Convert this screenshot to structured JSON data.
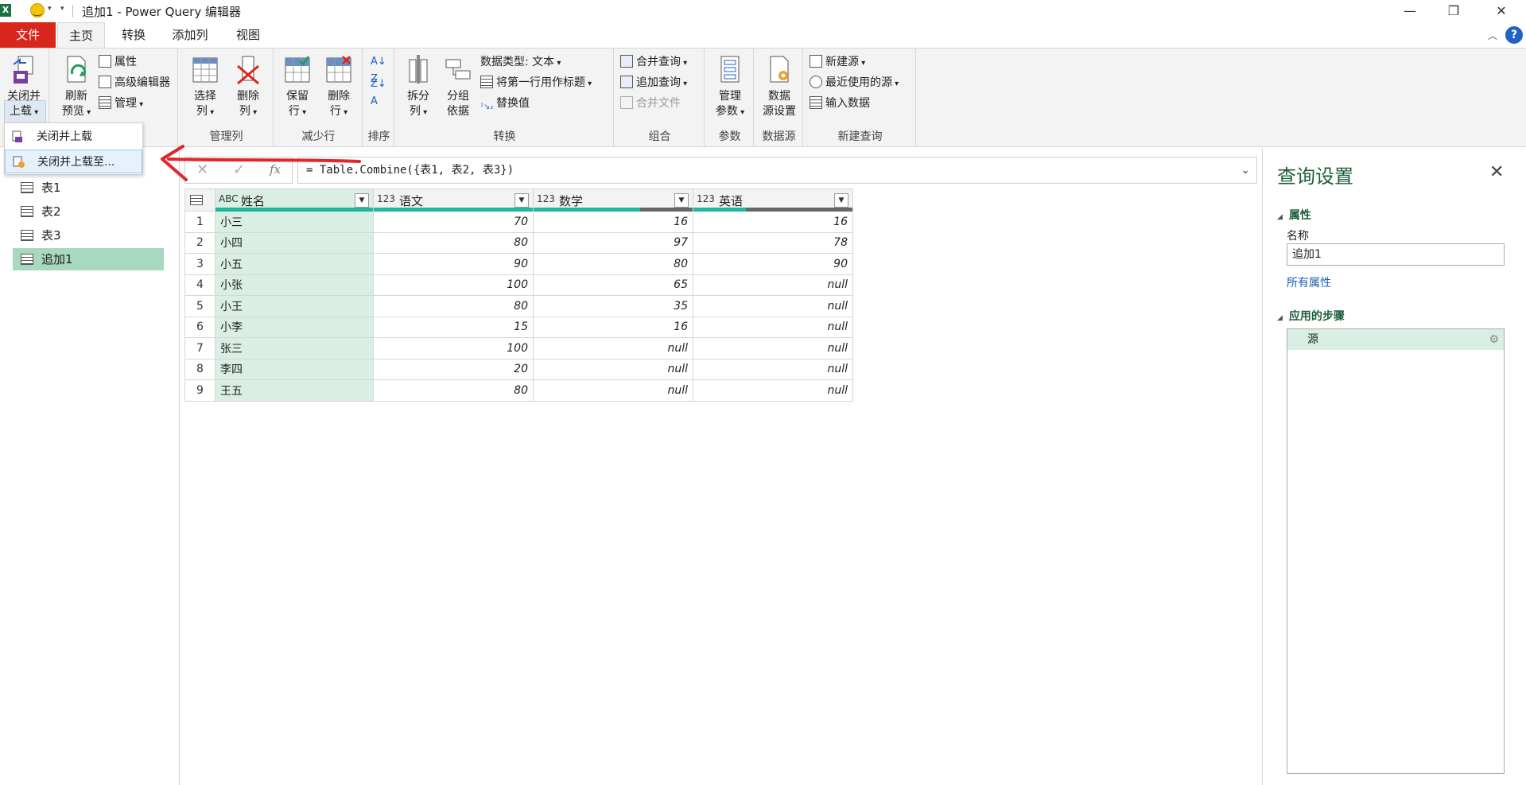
{
  "window": {
    "title": "追加1 - Power Query 编辑器",
    "app_icon": "X"
  },
  "tabs": [
    {
      "label": "文件"
    },
    {
      "label": "主页"
    },
    {
      "label": "转换"
    },
    {
      "label": "添加列"
    },
    {
      "label": "视图"
    }
  ],
  "ribbon": {
    "close_load": "关闭并",
    "close_load2": "上载",
    "refresh": "刷新",
    "refresh2": "预览",
    "properties": "属性",
    "advanced_editor": "高级编辑器",
    "manage": "管理",
    "choose_cols": "选择",
    "choose_cols2": "列",
    "remove_cols": "删除",
    "remove_cols2": "列",
    "keep_rows": "保留",
    "keep_rows2": "行",
    "remove_rows": "删除",
    "remove_rows2": "行",
    "split_col": "拆分",
    "split_col2": "列",
    "group_by": "分组",
    "group_by2": "依据",
    "data_type": "数据类型: 文本",
    "first_row_header": "将第一行用作标题",
    "replace_values": "替换值",
    "merge_queries": "合并查询",
    "append_queries": "追加查询",
    "combine_files": "合并文件",
    "manage_params": "管理",
    "manage_params2": "参数",
    "data_source_settings": "数据",
    "data_source_settings2": "源设置",
    "new_source": "新建源",
    "recent_sources": "最近使用的源",
    "enter_data": "输入数据",
    "groups": {
      "manage_cols": "管理列",
      "reduce_rows": "减少行",
      "sort": "排序",
      "transform": "转换",
      "combine": "组合",
      "params": "参数",
      "data_source": "数据源",
      "new_query": "新建查询"
    }
  },
  "menu": {
    "item1": "关闭并上载",
    "item2": "关闭并上载至..."
  },
  "queries": [
    {
      "label": "表1"
    },
    {
      "label": "表2"
    },
    {
      "label": "表3"
    },
    {
      "label": "追加1"
    }
  ],
  "formula": {
    "text": "= Table.Combine({表1, 表2, 表3})",
    "fx": "fx"
  },
  "grid": {
    "columns": [
      {
        "type": "ABC",
        "name": "姓名",
        "quality": 1.0
      },
      {
        "type": "123",
        "name": "语文",
        "quality": 1.0
      },
      {
        "type": "123",
        "name": "数学",
        "quality": 0.67
      },
      {
        "type": "123",
        "name": "英语",
        "quality": 0.33
      }
    ],
    "rows": [
      [
        "1",
        "小三",
        "70",
        "16",
        "16"
      ],
      [
        "2",
        "小四",
        "80",
        "97",
        "78"
      ],
      [
        "3",
        "小五",
        "90",
        "80",
        "90"
      ],
      [
        "4",
        "小张",
        "100",
        "65",
        "null"
      ],
      [
        "5",
        "小王",
        "80",
        "35",
        "null"
      ],
      [
        "6",
        "小李",
        "15",
        "16",
        "null"
      ],
      [
        "7",
        "张三",
        "100",
        "null",
        "null"
      ],
      [
        "8",
        "李四",
        "20",
        "null",
        "null"
      ],
      [
        "9",
        "王五",
        "80",
        "null",
        "null"
      ]
    ]
  },
  "settings": {
    "title": "查询设置",
    "properties_header": "属性",
    "name_label": "名称",
    "name_value": "追加1",
    "all_properties": "所有属性",
    "steps_header": "应用的步骤",
    "steps": [
      {
        "label": "源"
      }
    ]
  },
  "colors": {
    "file_tab": "#d9261c",
    "selected_query": "#a8d8bd",
    "quality_bar": "#1fb89c",
    "accent_green": "#1b5e3a",
    "annotation_arrow": "#e0262b"
  }
}
